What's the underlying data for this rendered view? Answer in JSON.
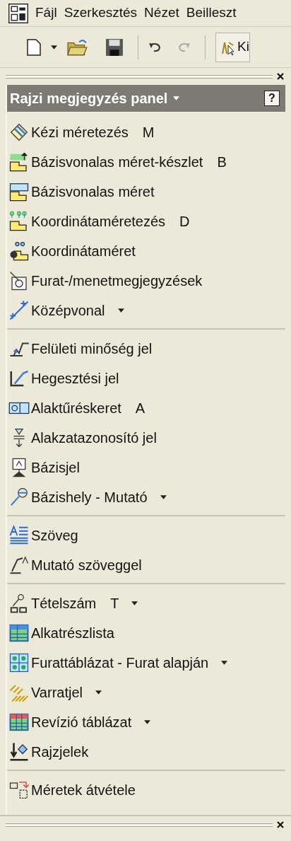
{
  "menu_bar": {
    "items": [
      "Fájl",
      "Szerkesztés",
      "Nézet",
      "Beilleszt"
    ]
  },
  "toolbar": {
    "cut_button_label": "Ki"
  },
  "panel": {
    "title": "Rajzi megjegyzés panel",
    "help": "?",
    "groups": [
      {
        "items": [
          {
            "label": "Kézi méretezés",
            "shortcut": "M",
            "has_dropdown": false
          },
          {
            "label": "Bázisvonalas méret-készlet",
            "shortcut": "B",
            "has_dropdown": false
          },
          {
            "label": "Bázisvonalas méret",
            "has_dropdown": false
          },
          {
            "label": "Koordinátaméretezés",
            "shortcut": "D",
            "has_dropdown": false
          },
          {
            "label": "Koordinátaméret",
            "has_dropdown": false
          },
          {
            "label": "Furat-/menetmegjegyzések",
            "has_dropdown": false
          },
          {
            "label": "Középvonal",
            "has_dropdown": true
          }
        ]
      },
      {
        "items": [
          {
            "label": "Felületi minőség jel",
            "has_dropdown": false
          },
          {
            "label": "Hegesztési jel",
            "has_dropdown": false
          },
          {
            "label": "Alaktűréskeret",
            "shortcut": "A",
            "has_dropdown": false
          },
          {
            "label": "Alakzatazonosító jel",
            "has_dropdown": false
          },
          {
            "label": "Bázisjel",
            "has_dropdown": false
          },
          {
            "label": "Bázishely - Mutató",
            "has_dropdown": true
          }
        ]
      },
      {
        "items": [
          {
            "label": "Szöveg",
            "has_dropdown": false
          },
          {
            "label": "Mutató szöveggel",
            "has_dropdown": false
          }
        ]
      },
      {
        "items": [
          {
            "label": "Tételszám",
            "shortcut": "T",
            "has_dropdown": true
          },
          {
            "label": "Alkatrészlista",
            "has_dropdown": false
          },
          {
            "label": "Furattáblázat - Furat alapján",
            "has_dropdown": true
          },
          {
            "label": "Varratjel",
            "has_dropdown": true
          },
          {
            "label": "Revízió táblázat",
            "has_dropdown": true
          },
          {
            "label": "Rajzjelek",
            "has_dropdown": false
          }
        ]
      },
      {
        "items": [
          {
            "label": "Méretek átvétele",
            "has_dropdown": false
          }
        ]
      }
    ]
  }
}
